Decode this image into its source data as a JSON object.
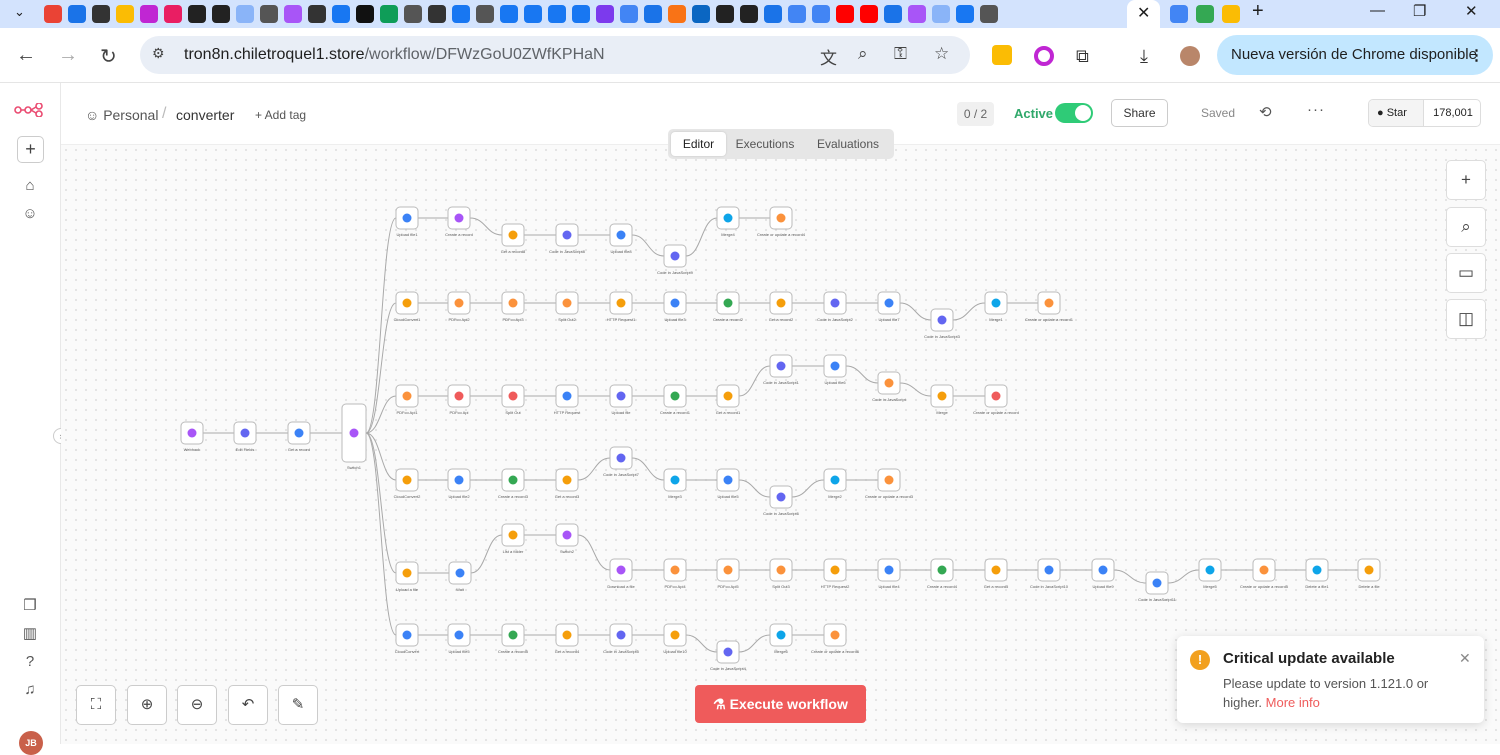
{
  "browser": {
    "url_host": "tron8n.chiletroquel1.store",
    "url_path": "/workflow/DFWzGoU0ZWfKPHaN",
    "update_pill": "Nueva versión de Chrome disponible"
  },
  "header": {
    "project": "Personal",
    "separator": "/",
    "workflow_name": "converter",
    "add_tag": "+ Add tag",
    "counter": "0 / 2",
    "active_label": "Active",
    "share": "Share",
    "saved": "Saved",
    "github_star": "Star",
    "github_count": "178,001"
  },
  "view_tabs": [
    "Editor",
    "Executions",
    "Evaluations"
  ],
  "execute_button": "Execute workflow",
  "toast": {
    "title": "Critical update available",
    "text": "Please update to version 1.121.0 or higher.",
    "link": "More info"
  },
  "colors": {
    "accent": "#ef5b5b",
    "active": "#2fcb77",
    "warning": "#f2a01e"
  },
  "nodes": {
    "trigger": [
      "Webhook",
      "Edit Fields",
      "Get a record",
      "Switch1"
    ],
    "row1": [
      "Upload file1",
      "Create a record",
      "Get a record8",
      "Code in JavaScript8",
      "Upload file8",
      "Code in JavaScript9",
      "Merge4",
      "Create or update a record4"
    ],
    "row2": [
      "CloudConvert1",
      "PDFco Api2",
      "PDFco Api3",
      "Split Out2",
      "HTTP Request1",
      "Upload file3",
      "Create a record2",
      "Get a record2",
      "Code in JavaScript2",
      "Upload file7",
      "Code in JavaScript3",
      "Merge1",
      "Create or update a record1"
    ],
    "row3": [
      "PDFco Api1",
      "PDFco Api",
      "Split Out",
      "HTTP Request",
      "Upload file",
      "Create a record1",
      "Get a record1",
      "Code in JavaScript1",
      "Upload file6",
      "Code in JavaScript",
      "Merge",
      "Create or update a record"
    ],
    "row4": [
      "CloudConvert2",
      "Upload file2",
      "Create a record3",
      "Get a record3",
      "Code in JavaScript7",
      "Merge3",
      "Upload file5",
      "Code in JavaScript6",
      "Merge2",
      "Create or update a record3"
    ],
    "row5": [
      "Upload a file",
      "Wait",
      "List a folder",
      "Switch2",
      "Download a file",
      "PDFco Api4",
      "PDFco Api5",
      "Split Out3",
      "HTTP Request2",
      "Upload file4",
      "Create a record4",
      "Get a record5",
      "Code in JavaScript10",
      "Upload file9",
      "Code in JavaScript11",
      "Merge5",
      "Create or update a record5",
      "Delete a file1",
      "Delete a file"
    ],
    "row6": [
      "CloudConvert",
      "Upload file5",
      "Create a record5",
      "Get a record4",
      "Code in JavaScript5",
      "Upload file10",
      "Code in JavaScript4",
      "Merge6",
      "Create or update a record6"
    ]
  }
}
